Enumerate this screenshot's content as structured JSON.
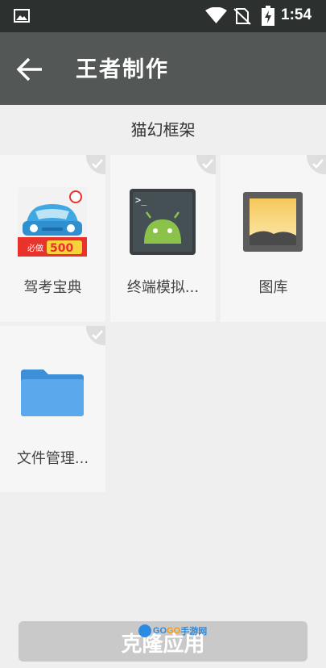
{
  "status_bar": {
    "time": "1:54",
    "icons": [
      "image-icon",
      "wifi-icon",
      "no-sim-icon",
      "battery-charging-icon"
    ]
  },
  "toolbar": {
    "back_icon": "arrow-left-icon",
    "title": "王者制作"
  },
  "section": {
    "title": "猫幻框架"
  },
  "apps": [
    {
      "label": "驾考宝典",
      "icon": "car-exam-icon",
      "icon_badge": "必做500题",
      "checked": true
    },
    {
      "label": "终端模拟...",
      "icon": "android-terminal-icon",
      "checked": true
    },
    {
      "label": "图库",
      "icon": "gallery-icon",
      "checked": true
    },
    {
      "label": "文件管理...",
      "icon": "folder-icon",
      "checked": true
    }
  ],
  "bottom_button": {
    "label": "克隆应用"
  },
  "watermark": {
    "text_a": "GO",
    "text_b": "GO",
    "text_c": "手游网"
  },
  "colors": {
    "status_bar": "#2c302f",
    "toolbar": "#535856",
    "background": "#efefef",
    "tile": "#f6f6f6",
    "check_badge": "#dedede",
    "folder_blue": "#4c9de6"
  }
}
